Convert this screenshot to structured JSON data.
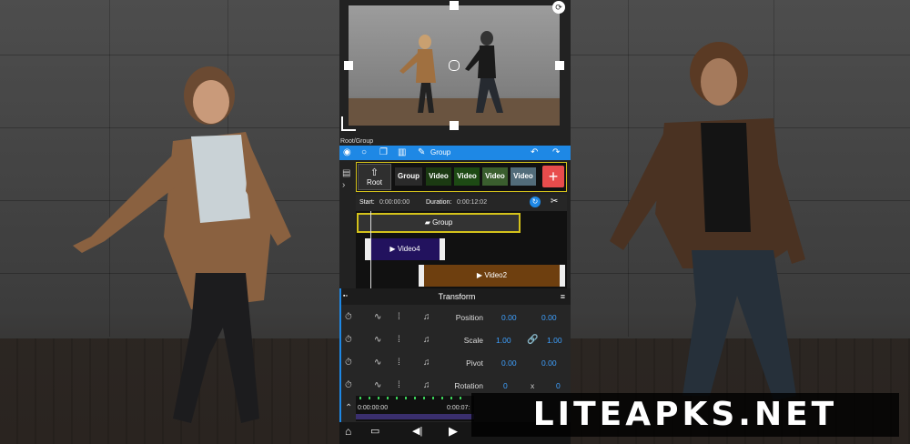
{
  "breadcrumb": "Root/Group",
  "toolbar": {
    "title": "Group",
    "icons": [
      "eye-icon",
      "circle-icon",
      "copy-icon",
      "trash-icon",
      "edit-icon",
      "undo-icon",
      "redo-icon"
    ]
  },
  "layer_strip": {
    "root_label": "Root",
    "items": [
      {
        "label": "Group",
        "color": "#2a2a2a"
      },
      {
        "label": "Video",
        "color": "#1b3a12"
      },
      {
        "label": "Video",
        "color": "#1d4a14"
      },
      {
        "label": "Video",
        "color": "#3a5e2e"
      },
      {
        "label": "Video",
        "color": "#526c7a"
      }
    ],
    "add_label": "+"
  },
  "timeline_info": {
    "start_label": "Start:",
    "start_value": "0:00:00:00",
    "duration_label": "Duration:",
    "duration_value": "0:00:12:02"
  },
  "tracks": [
    {
      "label": "Group",
      "color": "#333333",
      "border": "#d4c21b"
    },
    {
      "label": "Video4",
      "color": "#22125e"
    },
    {
      "label": "Video2",
      "color": "#6e3f0f"
    }
  ],
  "transform_panel": {
    "title": "Transform",
    "rows": [
      {
        "label": "Position",
        "v1": "0.00",
        "mid": "",
        "v2": "0.00"
      },
      {
        "label": "Scale",
        "v1": "1.00",
        "mid": "link-icon",
        "v2": "1.00"
      },
      {
        "label": "Pivot",
        "v1": "0.00",
        "mid": "",
        "v2": "0.00"
      },
      {
        "label": "Rotation",
        "v1": "0",
        "mid": "x",
        "v2": "0"
      }
    ]
  },
  "mini_timeline": {
    "time_start": "0:00:00:00",
    "time_current": "0:00:07:"
  },
  "watermark": "LITEAPKS.NET",
  "colors": {
    "accent": "#1e88e5",
    "add_button": "#e84c4c",
    "highlight": "#d4c21b"
  }
}
